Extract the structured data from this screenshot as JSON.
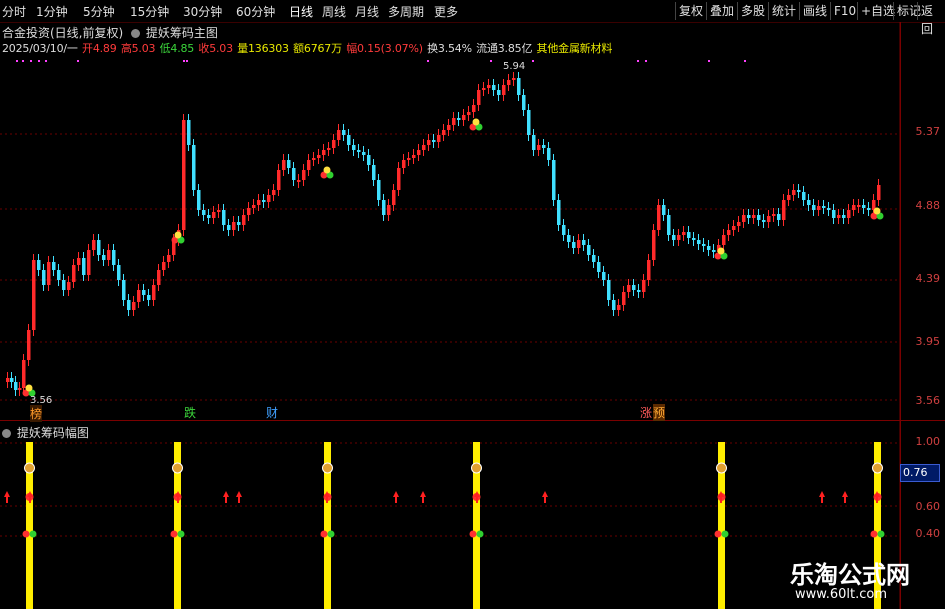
{
  "toolbar": {
    "left_items": [
      "分时",
      "1分钟",
      "5分钟",
      "15分钟",
      "30分钟",
      "60分钟",
      "日线",
      "周线",
      "月线",
      "多周期",
      "更多"
    ],
    "active": "日线",
    "right_items": [
      "复权",
      "叠加",
      "多股",
      "统计",
      "画线",
      "F10",
      "+自选",
      "标记",
      "返回"
    ]
  },
  "title": {
    "stock": "合金投资(日线,前复权)",
    "indicator": "提妖筹码主图"
  },
  "quote": {
    "date": "2025/03/10/一",
    "open": "开4.89",
    "high": "高5.03",
    "low": "低4.85",
    "close": "收5.03",
    "volume": "量136303",
    "amount": "额6767万",
    "change": "幅0.15(3.07%)",
    "turnover": "换3.54%",
    "float": "流通3.85亿",
    "sector": "其他金属新材料"
  },
  "colors": {
    "up": "#ff2a2a",
    "down": "#40e0ff",
    "grid": "#6a0000",
    "yellow": "#ffee00"
  },
  "price_axis": [
    "5.37",
    "4.88",
    "4.39",
    "3.95",
    "3.56"
  ],
  "sub_axis": [
    "1.00",
    "0.60",
    "0.40"
  ],
  "current_value": "0.76",
  "peak_label": "5.94",
  "low_label": "3.56",
  "event_marks": [
    "榜",
    "跌",
    "财",
    "涨",
    "预"
  ],
  "sub_title": "提妖筹码幅图",
  "watermark": {
    "main": "乐淘公式网",
    "url": "www.60lt.com"
  }
}
